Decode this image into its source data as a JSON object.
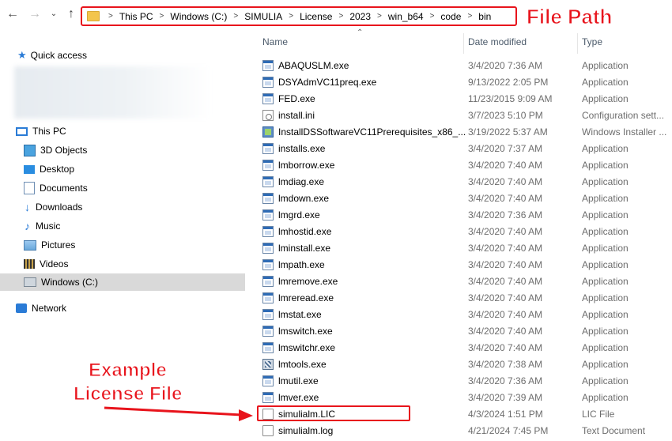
{
  "toolbar": {
    "back_icon": "back-arrow-icon",
    "forward_icon": "forward-arrow-icon",
    "recent_icon": "chevron-down-icon",
    "up_icon": "up-arrow-icon"
  },
  "address": {
    "crumbs": [
      "This PC",
      "Windows (C:)",
      "SIMULIA",
      "License",
      "2023",
      "win_b64",
      "code",
      "bin"
    ]
  },
  "annotations": {
    "file_path": "File Path",
    "example_line1": "Example",
    "example_line2": "License File",
    "accent_color": "#e8141c"
  },
  "sidebar": {
    "quick_access": "Quick access",
    "this_pc": "This PC",
    "items": [
      "3D Objects",
      "Desktop",
      "Documents",
      "Downloads",
      "Music",
      "Pictures",
      "Videos",
      "Windows (C:)"
    ],
    "network": "Network"
  },
  "columns": {
    "name": "Name",
    "date": "Date modified",
    "type": "Type"
  },
  "files": [
    {
      "name": "ABAQUSLM.exe",
      "date": "3/4/2020 7:36 AM",
      "type": "Application",
      "icon": "app"
    },
    {
      "name": "DSYAdmVC11preq.exe",
      "date": "9/13/2022 2:05 PM",
      "type": "Application",
      "icon": "app"
    },
    {
      "name": "FED.exe",
      "date": "11/23/2015 9:09 AM",
      "type": "Application",
      "icon": "app"
    },
    {
      "name": "install.ini",
      "date": "3/7/2023 5:10 PM",
      "type": "Configuration sett...",
      "icon": "cfg"
    },
    {
      "name": "InstallDSSoftwareVC11Prerequisites_x86_...",
      "date": "3/19/2022 5:37 AM",
      "type": "Windows Installer ...",
      "icon": "msi"
    },
    {
      "name": "installs.exe",
      "date": "3/4/2020 7:37 AM",
      "type": "Application",
      "icon": "app"
    },
    {
      "name": "lmborrow.exe",
      "date": "3/4/2020 7:40 AM",
      "type": "Application",
      "icon": "app"
    },
    {
      "name": "lmdiag.exe",
      "date": "3/4/2020 7:40 AM",
      "type": "Application",
      "icon": "app"
    },
    {
      "name": "lmdown.exe",
      "date": "3/4/2020 7:40 AM",
      "type": "Application",
      "icon": "app"
    },
    {
      "name": "lmgrd.exe",
      "date": "3/4/2020 7:36 AM",
      "type": "Application",
      "icon": "app"
    },
    {
      "name": "lmhostid.exe",
      "date": "3/4/2020 7:40 AM",
      "type": "Application",
      "icon": "app"
    },
    {
      "name": "lminstall.exe",
      "date": "3/4/2020 7:40 AM",
      "type": "Application",
      "icon": "app"
    },
    {
      "name": "lmpath.exe",
      "date": "3/4/2020 7:40 AM",
      "type": "Application",
      "icon": "app"
    },
    {
      "name": "lmremove.exe",
      "date": "3/4/2020 7:40 AM",
      "type": "Application",
      "icon": "app"
    },
    {
      "name": "lmreread.exe",
      "date": "3/4/2020 7:40 AM",
      "type": "Application",
      "icon": "app"
    },
    {
      "name": "lmstat.exe",
      "date": "3/4/2020 7:40 AM",
      "type": "Application",
      "icon": "app"
    },
    {
      "name": "lmswitch.exe",
      "date": "3/4/2020 7:40 AM",
      "type": "Application",
      "icon": "app"
    },
    {
      "name": "lmswitchr.exe",
      "date": "3/4/2020 7:40 AM",
      "type": "Application",
      "icon": "app"
    },
    {
      "name": "lmtools.exe",
      "date": "3/4/2020 7:38 AM",
      "type": "Application",
      "icon": "tools"
    },
    {
      "name": "lmutil.exe",
      "date": "3/4/2020 7:36 AM",
      "type": "Application",
      "icon": "app"
    },
    {
      "name": "lmver.exe",
      "date": "3/4/2020 7:39 AM",
      "type": "Application",
      "icon": "app"
    },
    {
      "name": "simulialm.LIC",
      "date": "4/3/2024 1:51 PM",
      "type": "LIC File",
      "icon": "doc"
    },
    {
      "name": "simulialm.log",
      "date": "4/21/2024 7:45 PM",
      "type": "Text Document",
      "icon": "doc"
    }
  ]
}
